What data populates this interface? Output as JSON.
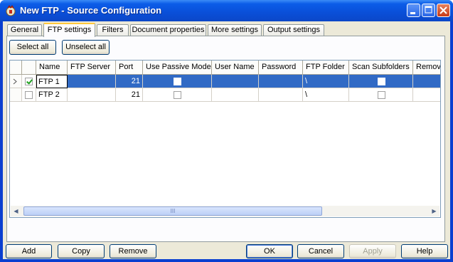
{
  "window": {
    "title": "New FTP - Source Configuration"
  },
  "tabs": [
    {
      "label": "General"
    },
    {
      "label": "FTP settings"
    },
    {
      "label": "Filters"
    },
    {
      "label": "Document properties"
    },
    {
      "label": "More settings"
    },
    {
      "label": "Output settings"
    }
  ],
  "active_tab": "FTP settings",
  "toolbar": {
    "select_all": "Select all",
    "unselect_all": "Unselect all"
  },
  "grid": {
    "columns": [
      "Name",
      "FTP Server",
      "Port",
      "Use Passive Mode",
      "User Name",
      "Password",
      "FTP Folder",
      "Scan Subfolders",
      "Remove"
    ],
    "rows": [
      {
        "checked": true,
        "name": "FTP 1",
        "server": "",
        "port": "21",
        "passive": false,
        "user": "",
        "password": "",
        "folder": "\\",
        "scan": false,
        "remove": "",
        "selected": true
      },
      {
        "checked": false,
        "name": "FTP 2",
        "server": "",
        "port": "21",
        "passive": false,
        "user": "",
        "password": "",
        "folder": "\\",
        "scan": false,
        "remove": "",
        "selected": false
      }
    ],
    "scroll_glyph": "III"
  },
  "footer": {
    "add": "Add",
    "copy": "Copy",
    "remove": "Remove",
    "ok": "OK",
    "cancel": "Cancel",
    "apply": "Apply",
    "help": "Help"
  },
  "colors": {
    "selection": "#316ac5",
    "titlebar": "#0a4fd8",
    "face": "#ece9d8"
  }
}
